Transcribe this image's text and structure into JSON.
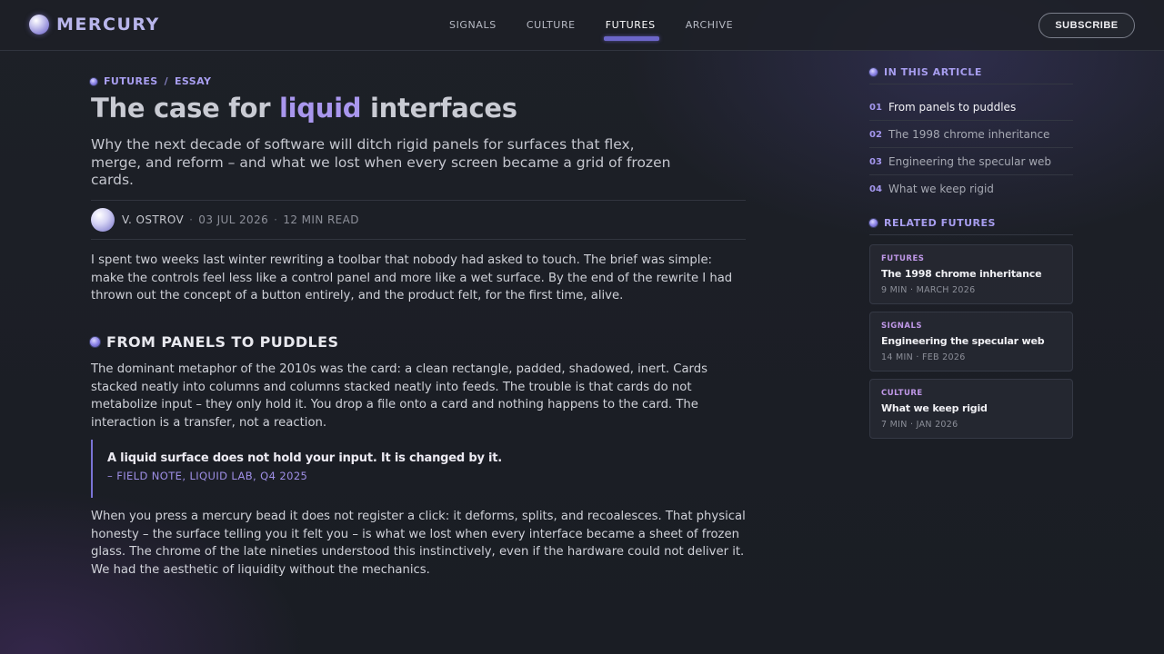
{
  "brand": {
    "name": "MERCURY",
    "logo_icon": "mercury-orb-icon"
  },
  "nav": {
    "items": [
      {
        "label": "SIGNALS",
        "active": false
      },
      {
        "label": "CULTURE",
        "active": false
      },
      {
        "label": "FUTURES",
        "active": true
      },
      {
        "label": "ARCHIVE",
        "active": false
      }
    ]
  },
  "header": {
    "subscribe_label": "SUBSCRIBE"
  },
  "article": {
    "breadcrumb": {
      "section": "FUTURES",
      "separator": "/",
      "type": "ESSAY"
    },
    "title_pre": "The case for ",
    "title_accent": "liquid",
    "title_post": " interfaces",
    "subtitle": "Why the next decade of software will ditch rigid panels for surfaces that flex, merge, and reform – and what we lost when every screen became a grid of frozen cards.",
    "meta": {
      "author": "V. OSTROV",
      "date": "03 JUL 2026",
      "read_time": "12 MIN READ",
      "separator": "·"
    },
    "paragraph_1": "I spent two weeks last winter rewriting a toolbar that nobody had asked to touch. The brief was simple: make the controls feel less like a control panel and more like a wet surface. By the end of the rewrite I had thrown out the concept of a button entirely, and the product felt, for the first time, alive.",
    "section_heading": "FROM PANELS TO PUDDLES",
    "paragraph_2": "The dominant metaphor of the 2010s was the card: a clean rectangle, padded, shadowed, inert. Cards stacked neatly into columns and columns stacked neatly into feeds. The trouble is that cards do not metabolize input – they only hold it. You drop a file onto a card and nothing happens to the card. The interaction is a transfer, not a reaction.",
    "quote": {
      "text": "A liquid surface does not hold your input. It is changed by it.",
      "cite": "– FIELD NOTE, LIQUID LAB, Q4 2025"
    },
    "paragraph_3": "When you press a mercury bead it does not register a click: it deforms, splits, and recoalesces. That physical honesty – the surface telling you it felt you – is what we lost when every interface became a sheet of frozen glass. The chrome of the late nineties understood this instinctively, even if the hardware could not deliver it. We had the aesthetic of liquidity without the mechanics."
  },
  "sidebar": {
    "toc_heading": "IN THIS ARTICLE",
    "toc": [
      {
        "num": "01",
        "label": "From panels to puddles",
        "active": true
      },
      {
        "num": "02",
        "label": "The 1998 chrome inheritance",
        "active": false
      },
      {
        "num": "03",
        "label": "Engineering the specular web",
        "active": false
      },
      {
        "num": "04",
        "label": "What we keep rigid",
        "active": false
      }
    ],
    "related_heading": "RELATED FUTURES",
    "related": [
      {
        "category": "FUTURES",
        "title": "The 1998 chrome inheritance",
        "meta": "9 MIN · MARCH 2026"
      },
      {
        "category": "SIGNALS",
        "title": "Engineering the specular web",
        "meta": "14 MIN · FEB 2026"
      },
      {
        "category": "CULTURE",
        "title": "What we keep rigid",
        "meta": "7 MIN · JAN 2026"
      }
    ]
  },
  "colors": {
    "accent": "#a997ee",
    "background": "#1b1e25",
    "text": "#cfd1d8"
  }
}
